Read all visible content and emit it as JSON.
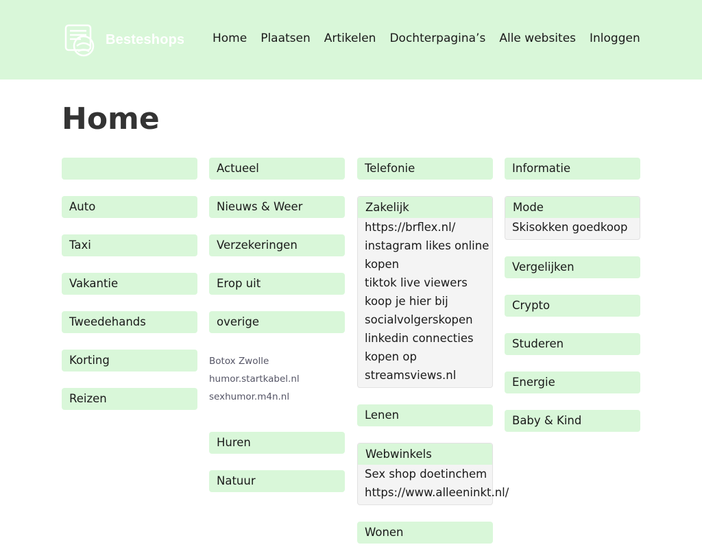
{
  "header": {
    "logo_text": "Besteshops :",
    "nav": [
      "Home",
      "Plaatsen",
      "Artikelen",
      "Dochterpagina’s",
      "Alle websites",
      "Inloggen"
    ]
  },
  "page": {
    "title": "Home"
  },
  "col1": [
    "",
    "Auto",
    "Taxi",
    "Vakantie",
    "Tweedehands",
    "Korting",
    "Reizen"
  ],
  "col2": {
    "top": [
      "Actueel",
      "Nieuws & Weer",
      "Verzekeringen",
      "Erop uit",
      "overige"
    ],
    "links": [
      "Botox Zwolle",
      "humor.startkabel.nl",
      "sexhumor.m4n.nl"
    ],
    "bottom": [
      "Huren",
      "Natuur"
    ]
  },
  "col3": {
    "telefonie": "Telefonie",
    "zakelijk": {
      "title": "Zakelijk",
      "links": [
        "https://brflex.nl/",
        "instagram likes online",
        "kopen",
        "tiktok live viewers",
        "koop je hier bij",
        "socialvolgerskopen",
        "linkedin connecties",
        "kopen op",
        "streamsviews.nl"
      ]
    },
    "lenen": "Lenen",
    "webwinkels": {
      "title": "Webwinkels",
      "links": [
        "Sex shop doetinchem",
        "https://www.alleeninkt.nl/"
      ]
    },
    "wonen": "Wonen"
  },
  "col4": {
    "informatie": "Informatie",
    "mode": {
      "title": "Mode",
      "links": [
        "Skisokken goedkoop"
      ]
    },
    "rest": [
      "Vergelijken",
      "Crypto",
      "Studeren",
      "Energie",
      "Baby & Kind"
    ]
  }
}
